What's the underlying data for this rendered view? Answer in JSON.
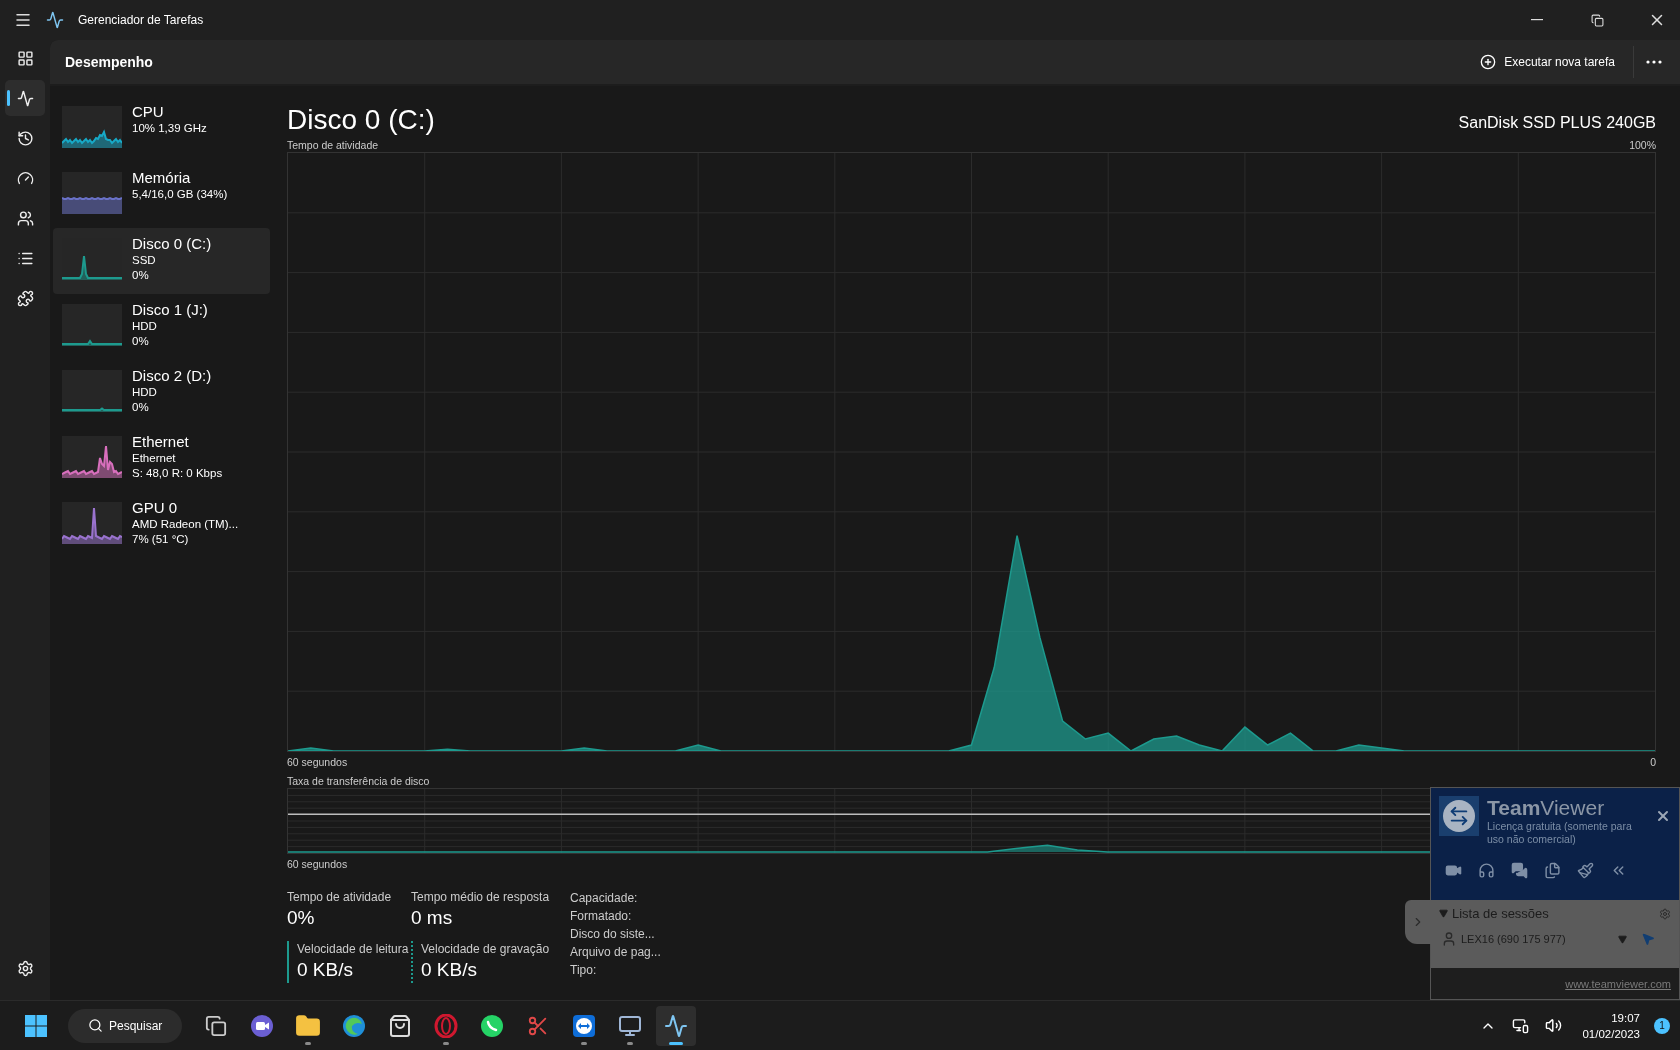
{
  "window": {
    "title": "Gerenciador de Tarefas"
  },
  "nav": {
    "items": [
      {
        "kind": "processes",
        "selected": false
      },
      {
        "kind": "performance",
        "selected": true
      },
      {
        "kind": "history",
        "selected": false
      },
      {
        "kind": "startup",
        "selected": false
      },
      {
        "kind": "users",
        "selected": false
      },
      {
        "kind": "details",
        "selected": false
      },
      {
        "kind": "services",
        "selected": false
      }
    ]
  },
  "header": {
    "title": "Desempenho",
    "action": "Executar nova tarefa"
  },
  "sidebar": {
    "items": [
      {
        "title": "CPU",
        "lines": [
          "10%  1,39 GHz"
        ],
        "color": "#17a9c7",
        "selected": false
      },
      {
        "title": "Memória",
        "lines": [
          "5,4/16,0 GB (34%)"
        ],
        "color": "#6a72c9",
        "selected": false
      },
      {
        "title": "Disco 0 (C:)",
        "lines": [
          "SSD",
          "0%"
        ],
        "color": "#1d9a8e",
        "selected": true
      },
      {
        "title": "Disco 1 (J:)",
        "lines": [
          "HDD",
          "0%"
        ],
        "color": "#1d9a8e",
        "selected": false
      },
      {
        "title": "Disco 2 (D:)",
        "lines": [
          "HDD",
          "0%"
        ],
        "color": "#1d9a8e",
        "selected": false
      },
      {
        "title": "Ethernet",
        "lines": [
          "Ethernet",
          "S: 48,0 R: 0 Kbps"
        ],
        "color": "#d86fbd",
        "selected": false
      },
      {
        "title": "GPU 0",
        "lines": [
          "AMD Radeon (TM)...",
          "7%  (51 °C)"
        ],
        "color": "#9a73cf",
        "selected": false
      }
    ]
  },
  "main": {
    "title": "Disco 0 (C:)",
    "model": "SanDisk SSD PLUS 240GB",
    "activity": {
      "title": "Tempo de atividade",
      "max_label": "100%",
      "span_label": "60 segundos",
      "min_label": "0"
    },
    "transfer": {
      "title": "Taxa de transferência de disco",
      "xlabel": "60 segundos"
    },
    "stats": [
      {
        "kind": "plain",
        "label": "Tempo de atividade",
        "value": "0%"
      },
      {
        "kind": "plain",
        "label": "Tempo médio de resposta",
        "value": "0 ms"
      },
      {
        "kind": "read",
        "label": "Velocidade de leitura",
        "value": "0 KB/s"
      },
      {
        "kind": "write",
        "label": "Velocidade de gravação",
        "value": "0 KB/s"
      }
    ],
    "properties": [
      "Capacidade:",
      "Formatado:",
      "Disco do siste...",
      "Arquivo de pag...",
      "Tipo:"
    ]
  },
  "teamviewer": {
    "title": "**Team**Viewer",
    "license": "Licença gratuita (somente para uso não comercial)",
    "sessions_title": "Lista de sessões",
    "sessions_expanded": true,
    "sessions": [
      "LEX16 (690 175 977)"
    ],
    "link": "www.teamviewer.com"
  },
  "taskbar": {
    "search": "Pesquisar",
    "apps": [
      {
        "kind": "taskview",
        "running": false,
        "active": false
      },
      {
        "kind": "meet",
        "running": false,
        "active": false
      },
      {
        "kind": "explorer",
        "running": true,
        "active": false
      },
      {
        "kind": "edge",
        "running": false,
        "active": false
      },
      {
        "kind": "store",
        "running": false,
        "active": false
      },
      {
        "kind": "opera",
        "running": true,
        "active": false
      },
      {
        "kind": "whatsapp",
        "running": false,
        "active": false
      },
      {
        "kind": "snip",
        "running": false,
        "active": false
      },
      {
        "kind": "teamviewer",
        "running": true,
        "active": false
      },
      {
        "kind": "network",
        "running": true,
        "active": false
      },
      {
        "kind": "taskmanager",
        "running": true,
        "active": true
      }
    ],
    "time": "19:07",
    "date": "01/02/2023",
    "notifications": "1"
  }
}
